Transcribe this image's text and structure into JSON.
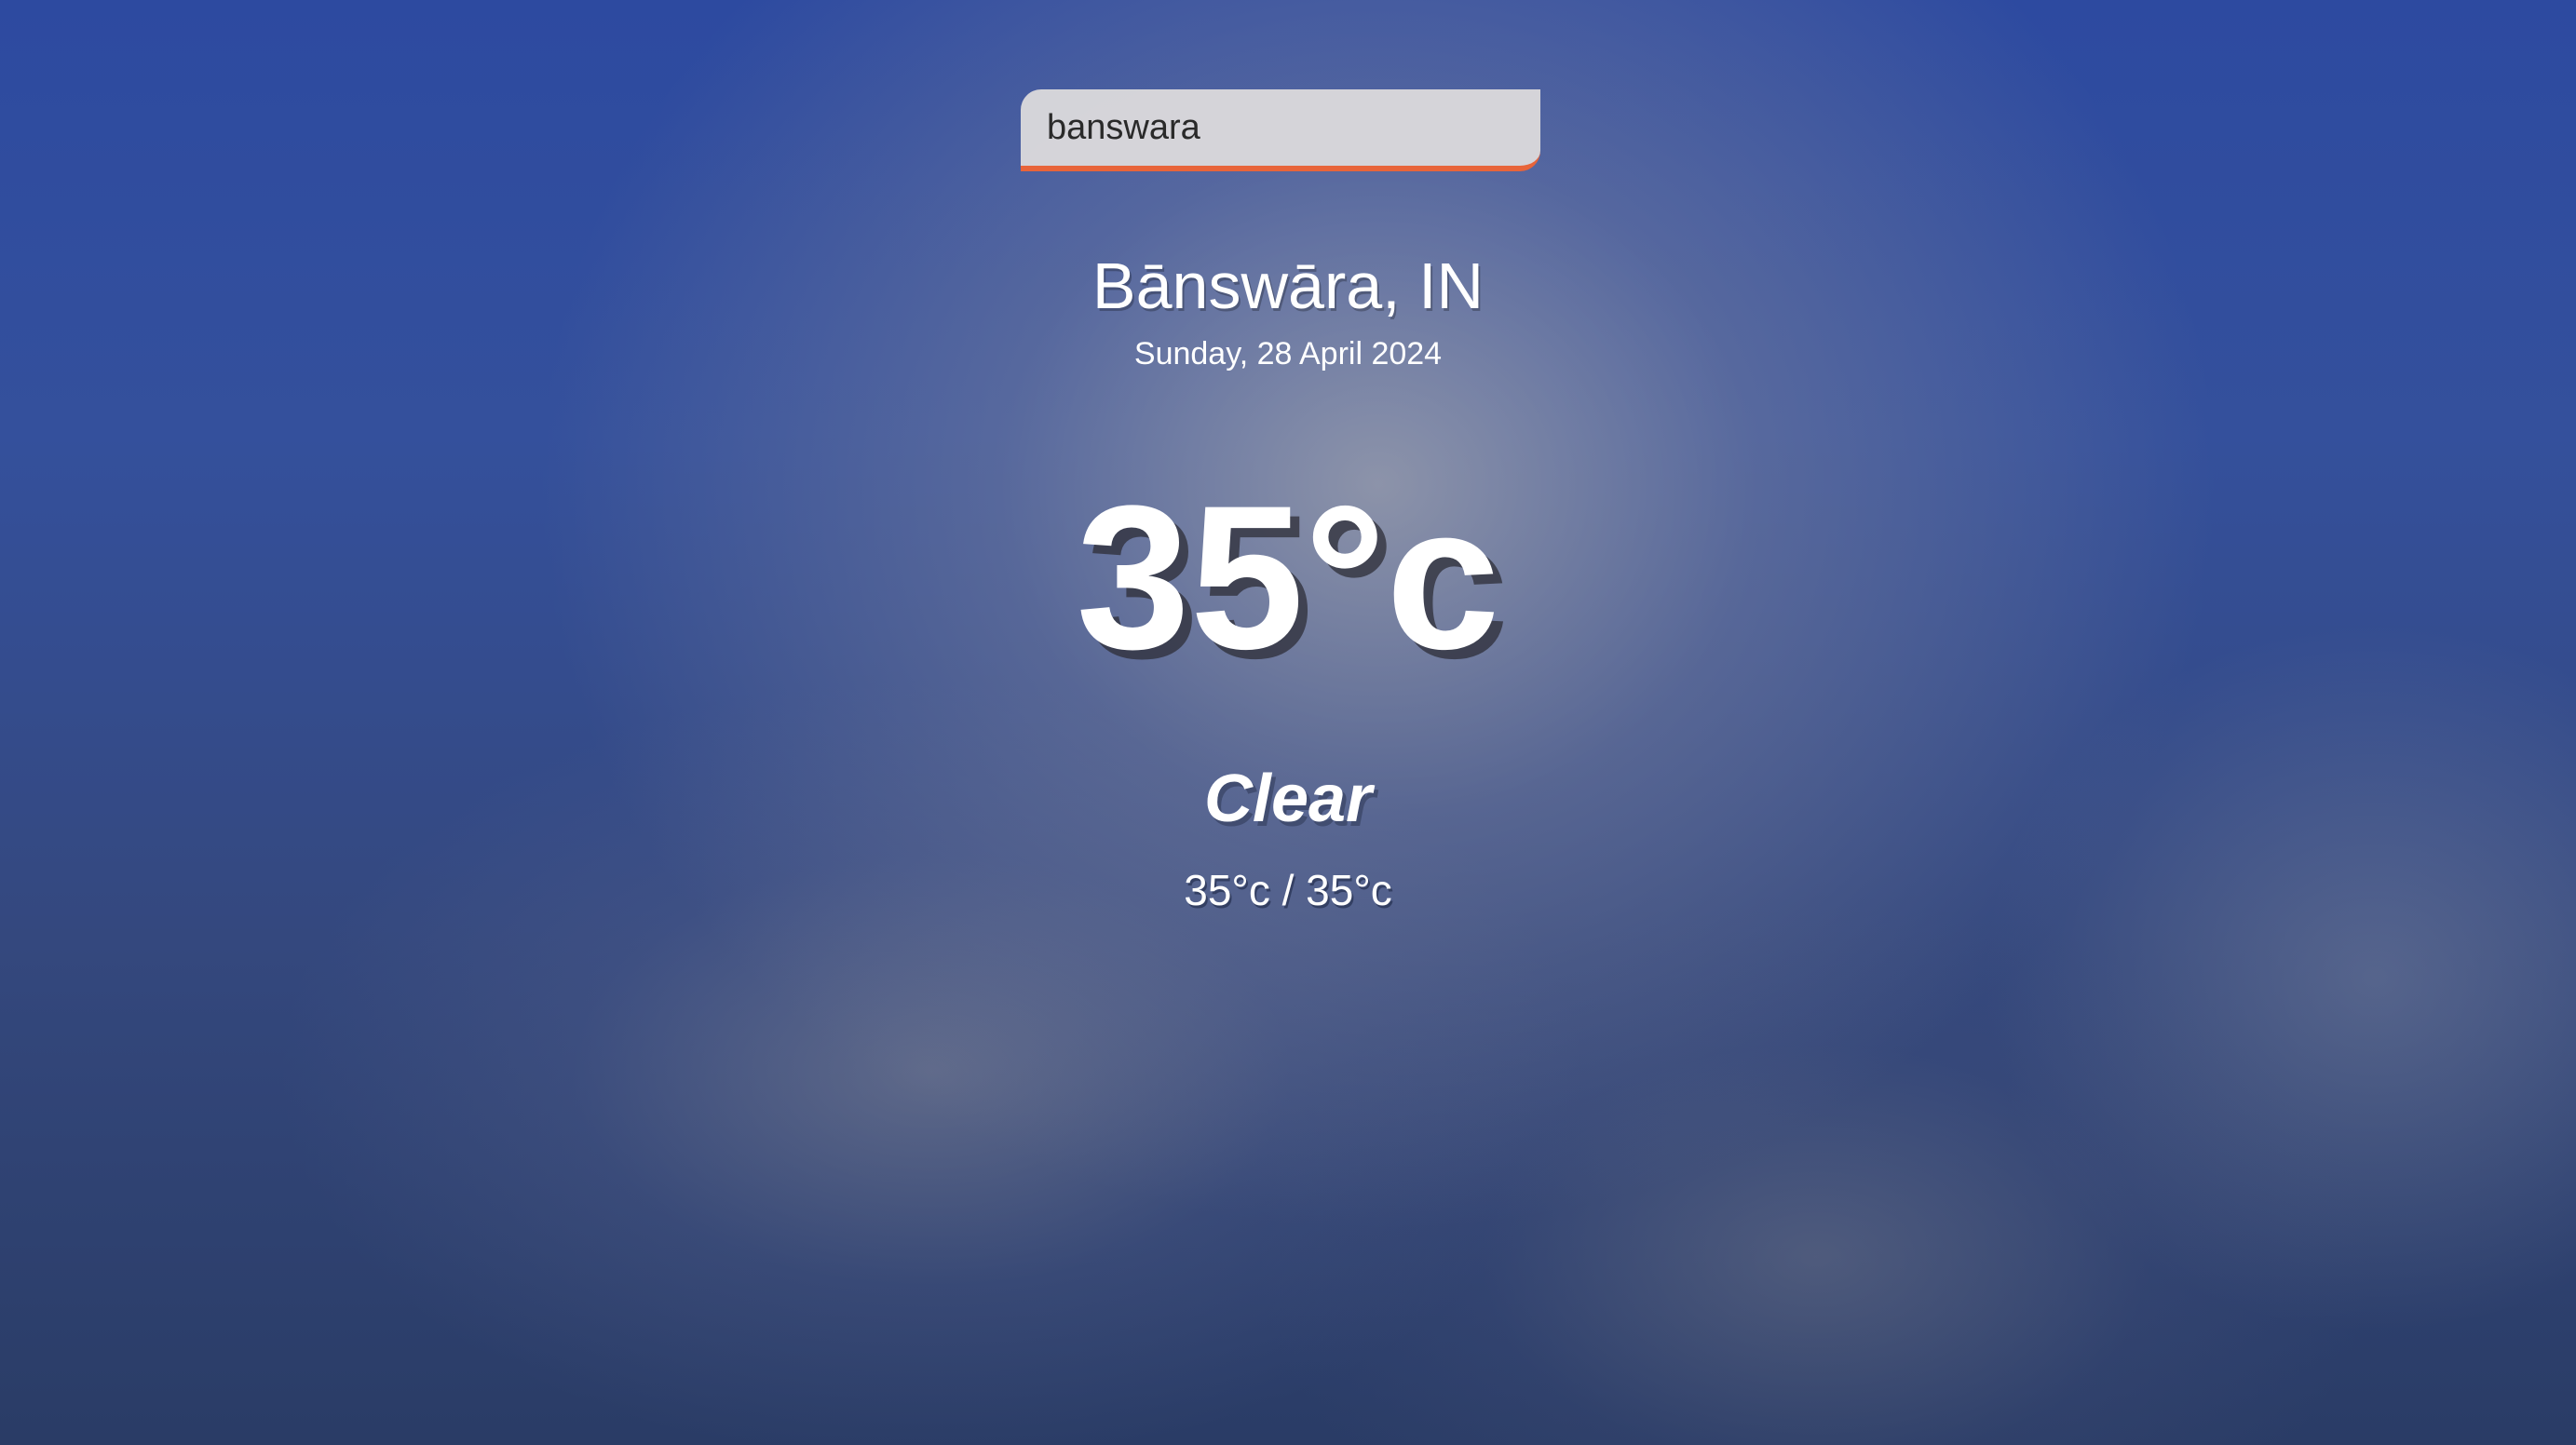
{
  "search": {
    "value": "banswara"
  },
  "weather": {
    "location": "Bānswāra, IN",
    "date": "Sunday, 28 April 2024",
    "temperature": "35°c",
    "condition": "Clear",
    "hi_low": "35°c / 35°c"
  },
  "colors": {
    "search_underline": "#e8643a",
    "search_background": "#dcdadc",
    "text": "#ffffff",
    "sky": "#2d4aa0"
  }
}
